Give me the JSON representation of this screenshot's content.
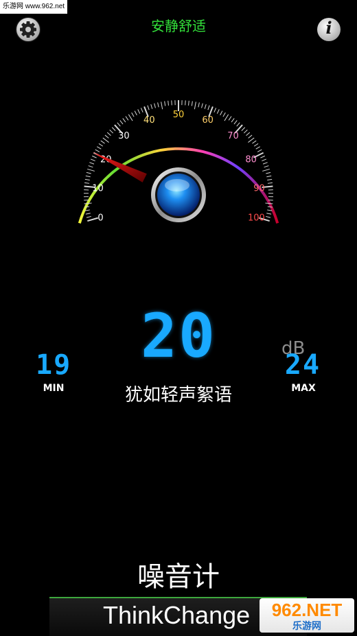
{
  "watermarks": {
    "top_left": "乐游网 www.962.net",
    "bottom_right_brand": "962.NET",
    "bottom_right_sub": "乐游网"
  },
  "header": {
    "status": "安静舒适",
    "settings_icon": "gear-icon",
    "info_icon": "info-icon",
    "info_glyph": "i"
  },
  "gauge": {
    "min": 0,
    "max": 100,
    "tick_labels": [
      "0",
      "10",
      "20",
      "30",
      "40",
      "50",
      "60",
      "70",
      "80",
      "90",
      "100"
    ],
    "needle_value": 20,
    "colors": [
      "#f2f53a",
      "#63dd33",
      "#ffd23a",
      "#ff3fb0",
      "#7040ff",
      "#c8002a"
    ]
  },
  "reading": {
    "value": "20",
    "unit": "dB",
    "description": "犹如轻声絮语"
  },
  "minmax": {
    "min_value": "19",
    "min_label": "MIN",
    "max_value": "24",
    "max_label": "MAX"
  },
  "footer": {
    "app_title": "噪音计",
    "brand": "ThinkChange"
  },
  "colors": {
    "accent_green": "#33e03a",
    "digit_blue": "#19a9ff"
  }
}
